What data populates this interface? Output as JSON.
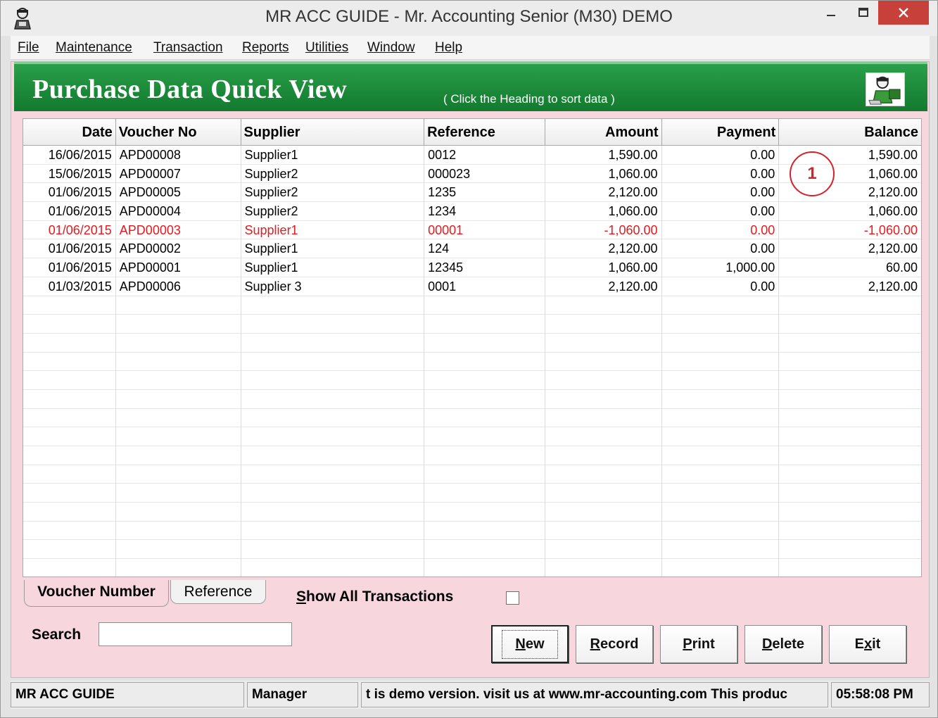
{
  "window": {
    "title": "MR ACC GUIDE - Mr. Accounting Senior (M30) DEMO"
  },
  "menu": {
    "file": "File",
    "maintenance": "Maintenance",
    "transaction": "Transaction",
    "reports": "Reports",
    "utilities": "Utilities",
    "window": "Window",
    "help": "Help"
  },
  "banner": {
    "title": "Purchase Data Quick View",
    "hint": "( Click the Heading to sort data )"
  },
  "grid": {
    "headers": {
      "date": "Date",
      "voucher": "Voucher No",
      "supplier": "Supplier",
      "reference": "Reference",
      "amount": "Amount",
      "payment": "Payment",
      "balance": "Balance"
    },
    "rows": [
      {
        "date": "16/06/2015",
        "voucher": "APD00008",
        "supplier": "Supplier1",
        "reference": "0012",
        "amount": "1,590.00",
        "payment": "0.00",
        "balance": "1,590.00",
        "negative": false
      },
      {
        "date": "15/06/2015",
        "voucher": "APD00007",
        "supplier": "Supplier2",
        "reference": "000023",
        "amount": "1,060.00",
        "payment": "0.00",
        "balance": "1,060.00",
        "negative": false
      },
      {
        "date": "01/06/2015",
        "voucher": "APD00005",
        "supplier": "Supplier2",
        "reference": "1235",
        "amount": "2,120.00",
        "payment": "0.00",
        "balance": "2,120.00",
        "negative": false
      },
      {
        "date": "01/06/2015",
        "voucher": "APD00004",
        "supplier": "Supplier2",
        "reference": "1234",
        "amount": "1,060.00",
        "payment": "0.00",
        "balance": "1,060.00",
        "negative": false
      },
      {
        "date": "01/06/2015",
        "voucher": "APD00003",
        "supplier": "Supplier1",
        "reference": "00001",
        "amount": "-1,060.00",
        "payment": "0.00",
        "balance": "-1,060.00",
        "negative": true
      },
      {
        "date": "01/06/2015",
        "voucher": "APD00002",
        "supplier": "Supplier1",
        "reference": "124",
        "amount": "2,120.00",
        "payment": "0.00",
        "balance": "2,120.00",
        "negative": false
      },
      {
        "date": "01/06/2015",
        "voucher": "APD00001",
        "supplier": "Supplier1",
        "reference": "12345",
        "amount": "1,060.00",
        "payment": "1,000.00",
        "balance": "60.00",
        "negative": false
      },
      {
        "date": "01/03/2015",
        "voucher": "APD00006",
        "supplier": "Supplier 3",
        "reference": "0001",
        "amount": "2,120.00",
        "payment": "0.00",
        "balance": "2,120.00",
        "negative": false
      }
    ],
    "empty_rows": 15
  },
  "annotation": {
    "label": "1"
  },
  "controls": {
    "tab_voucher": "Voucher Number",
    "tab_reference": "Reference",
    "show_all_first": "S",
    "show_all_rest": "how All Transactions",
    "search_label": "Search",
    "search_value": "",
    "buttons": {
      "new_u": "N",
      "new_rest": "ew",
      "record_u": "R",
      "record_rest": "ecord",
      "print_u": "P",
      "print_rest": "rint",
      "delete_u": "D",
      "delete_rest": "elete",
      "exit_a": "E",
      "exit_u": "x",
      "exit_rest": "it"
    }
  },
  "status": {
    "app": "MR ACC GUIDE",
    "user": "Manager",
    "message": "t is demo version.  visit us at www.mr-accounting.com This produc",
    "time": "05:58:08 PM"
  },
  "colors": {
    "banner_green": "#1c8a3a",
    "client_pink": "#f7d6de",
    "negative_red": "#e8191e",
    "close_red": "#c7413a"
  },
  "icons": {
    "app": "accountant-icon",
    "minimize": "minimize-icon",
    "maximize": "maximize-icon",
    "close": "close-icon"
  }
}
